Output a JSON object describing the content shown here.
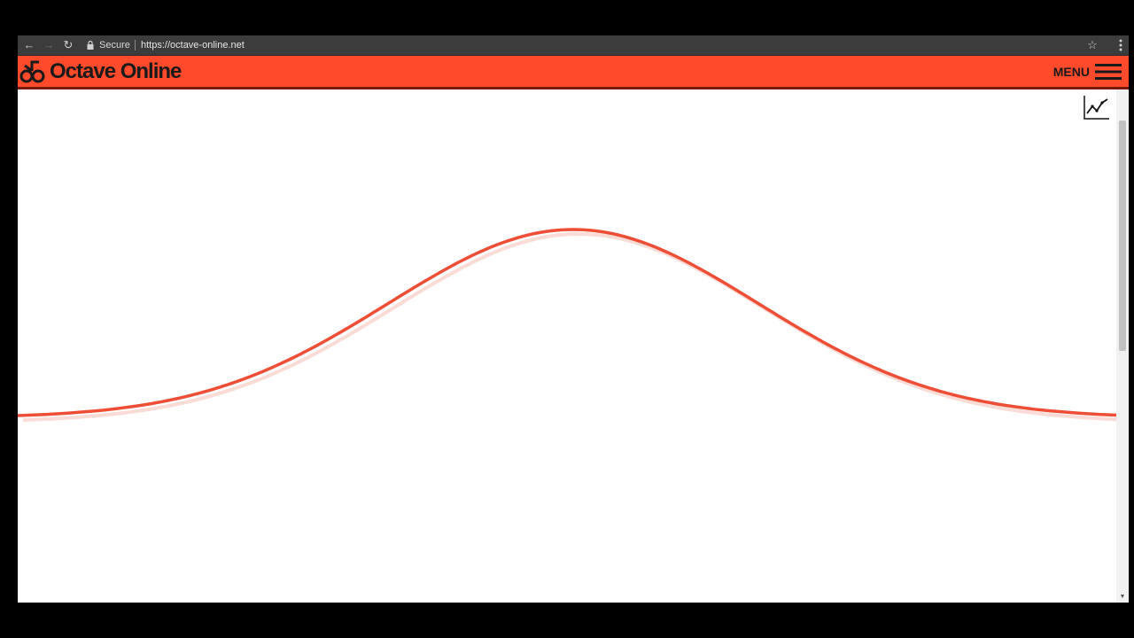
{
  "browser": {
    "back_icon": "back-arrow-icon",
    "forward_icon": "forward-arrow-icon",
    "reload_icon": "reload-icon",
    "secure_label": "Secure",
    "url": "https://octave-online.net",
    "bookmark_icon": "star-icon",
    "menu_icon": "vertical-dots-icon"
  },
  "app": {
    "logo_text": "Octave Online",
    "menu_label": "MENU",
    "brand_color": "#ff4a2b"
  },
  "chart_data": {
    "type": "line",
    "title": "",
    "xlabel": "",
    "ylabel": "",
    "grid": false,
    "series": [
      {
        "color": "#ee4e36",
        "x": [
          -3,
          -2.5,
          -2,
          -1.5,
          -1,
          -0.5,
          0,
          0.5,
          1,
          1.5,
          2,
          2.5,
          3
        ],
        "y": [
          0.011,
          0.044,
          0.135,
          0.325,
          0.607,
          0.882,
          1.0,
          0.882,
          0.607,
          0.325,
          0.135,
          0.044,
          0.011
        ]
      }
    ]
  }
}
